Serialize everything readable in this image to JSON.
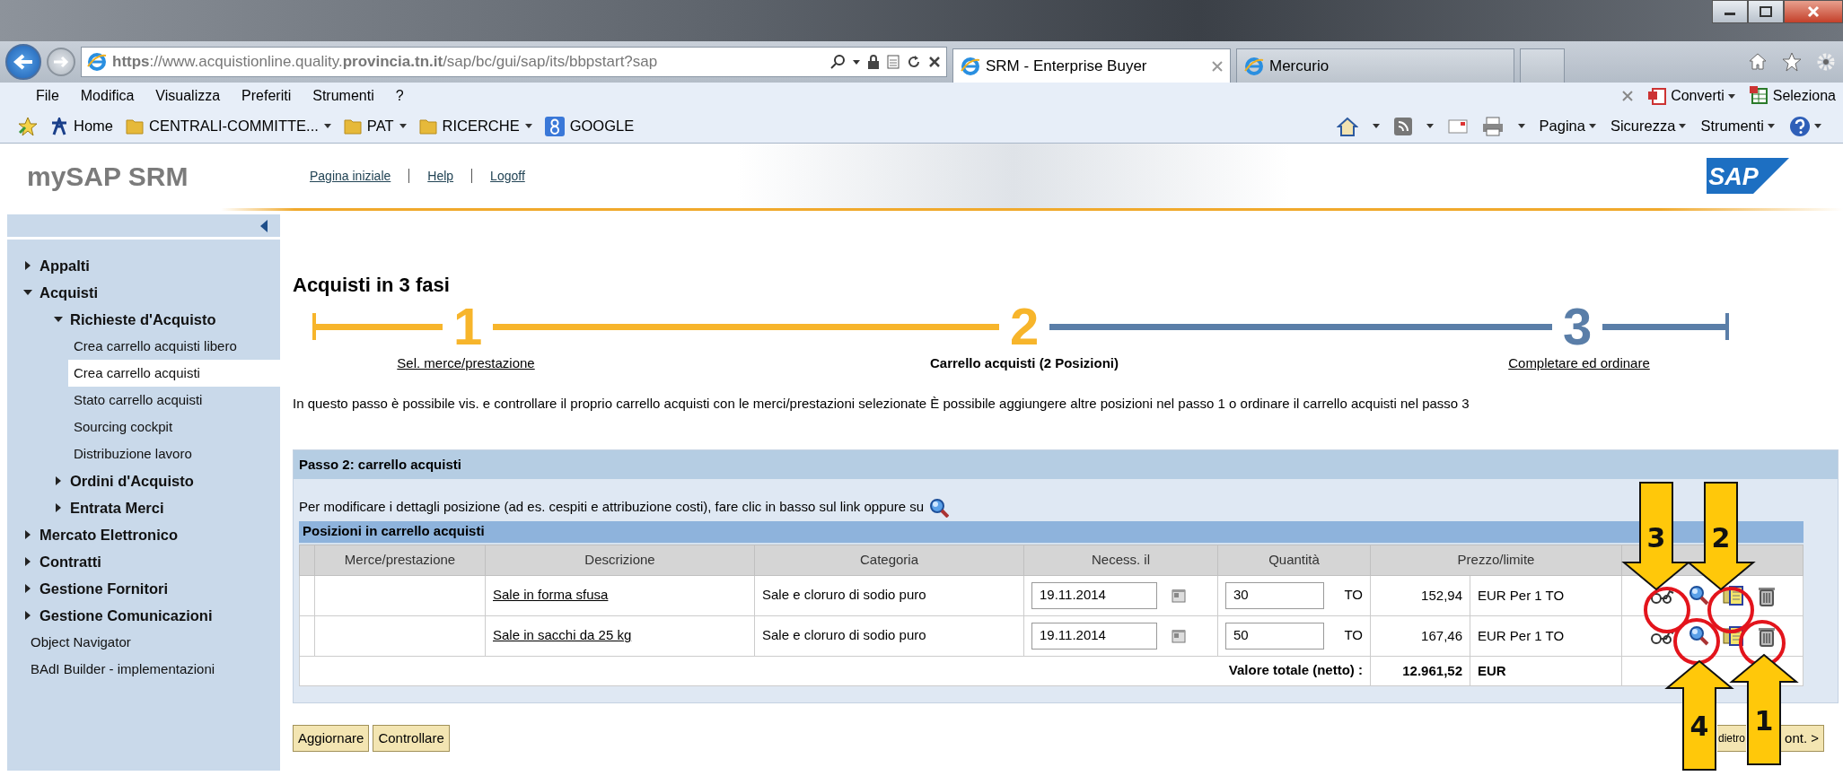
{
  "browser": {
    "address": "**https**://www.acquistionline.quality.**provincia.tn.it**/sap/bc/gui/sap/its/bbpstart?sap",
    "tabs": [
      {
        "label": "SRM - Enterprise Buyer",
        "selected": true
      },
      {
        "label": "Mercurio",
        "selected": false
      }
    ],
    "menu": [
      "File",
      "Modifica",
      "Visualizza",
      "Preferiti",
      "Strumenti",
      "?"
    ],
    "favorites": [
      {
        "label": "Home",
        "kind": "site",
        "dropdown": false
      },
      {
        "label": "CENTRALI-COMMITTE...",
        "kind": "folder",
        "dropdown": true
      },
      {
        "label": "PAT",
        "kind": "folder",
        "dropdown": true
      },
      {
        "label": "RICERCHE",
        "kind": "folder",
        "dropdown": true
      },
      {
        "label": "GOOGLE",
        "kind": "google",
        "dropdown": false
      }
    ],
    "pdf_tools": [
      "Converti",
      "Seleziona"
    ],
    "commands": [
      "Pagina",
      "Sicurezza",
      "Strumenti"
    ]
  },
  "header": {
    "logo": "mySAP SRM",
    "links": [
      "Pagina iniziale",
      "Help",
      "Logoff"
    ],
    "brand": "SAP"
  },
  "sidebar": {
    "items": [
      {
        "label": "Appalti",
        "kind": "folder",
        "expanded": false
      },
      {
        "label": "Acquisti",
        "kind": "folder",
        "expanded": true,
        "children": [
          {
            "label": "Richieste d'Acquisto",
            "kind": "folder",
            "expanded": true,
            "children": [
              {
                "label": "Crea carrello acquisti libero",
                "kind": "link",
                "selected": false
              },
              {
                "label": "Crea carrello acquisti",
                "kind": "link",
                "selected": true
              },
              {
                "label": "Stato carrello acquisti",
                "kind": "link",
                "selected": false
              },
              {
                "label": "Sourcing cockpit",
                "kind": "link",
                "selected": false
              },
              {
                "label": "Distribuzione lavoro",
                "kind": "link",
                "selected": false
              }
            ]
          },
          {
            "label": "Ordini d'Acquisto",
            "kind": "folder",
            "expanded": false
          },
          {
            "label": "Entrata Merci",
            "kind": "folder",
            "expanded": false
          }
        ]
      },
      {
        "label": "Mercato Elettronico",
        "kind": "folder",
        "expanded": false
      },
      {
        "label": "Contratti",
        "kind": "folder",
        "expanded": false
      },
      {
        "label": "Gestione Fornitori",
        "kind": "folder",
        "expanded": false
      },
      {
        "label": "Gestione Comunicazioni",
        "kind": "folder",
        "expanded": false
      },
      {
        "label": "Object Navigator",
        "kind": "link",
        "selected": false
      },
      {
        "label": "BAdI Builder - implementazioni",
        "kind": "link",
        "selected": false
      }
    ]
  },
  "main": {
    "title": "Acquisti in 3 fasi",
    "steps": [
      {
        "number": "1",
        "label": "Sel. merce/prestazione",
        "done": true,
        "current": false
      },
      {
        "number": "2",
        "label": "Carrello acquisti (2 Posizioni)",
        "done": false,
        "current": true
      },
      {
        "number": "3",
        "label": "Completare ed ordinare",
        "done": false,
        "current": false
      }
    ],
    "description": "In questo passo è possibile vis. e controllare il proprio carrello acquisti con le merci/prestazioni selezionate È possibile aggiungere altre posizioni nel passo 1 o ordinare il carrello acquisti nel passo 3",
    "panel": {
      "title": "Passo 2: carrello acquisti",
      "hint": "Per modificare i dettagli posizione (ad es. cespiti e attribuzione costi), fare clic in basso sul link oppure su",
      "table": {
        "title": "Posizioni in carrello acquisti",
        "columns": [
          "Merce/prestazione",
          "Descrizione",
          "Categoria",
          "Necess. il",
          "Quantità",
          "Prezzo/limite"
        ],
        "rows": [
          {
            "description": "Sale in forma sfusa",
            "category": "Sale e cloruro di sodio puro",
            "date": "19.11.2014",
            "quantity": "30",
            "unit": "TO",
            "price": "152,94",
            "price_unit": "EUR Per 1 TO"
          },
          {
            "description": "Sale in sacchi da 25 kg",
            "category": "Sale e cloruro di sodio puro",
            "date": "19.11.2014",
            "quantity": "50",
            "unit": "TO",
            "price": "167,46",
            "price_unit": "EUR Per 1 TO"
          }
        ],
        "total": {
          "label": "Valore totale (netto) :",
          "value": "12.961,52",
          "currency": "EUR"
        }
      }
    },
    "buttons": [
      "Aggiornare",
      "Controllare"
    ],
    "nav_buttons": [
      "dietro",
      "ont. >"
    ]
  },
  "annotations": [
    {
      "number": "3",
      "points_up": false
    },
    {
      "number": "2",
      "points_up": false
    },
    {
      "number": "4",
      "points_up": true
    },
    {
      "number": "1",
      "points_up": true
    }
  ]
}
